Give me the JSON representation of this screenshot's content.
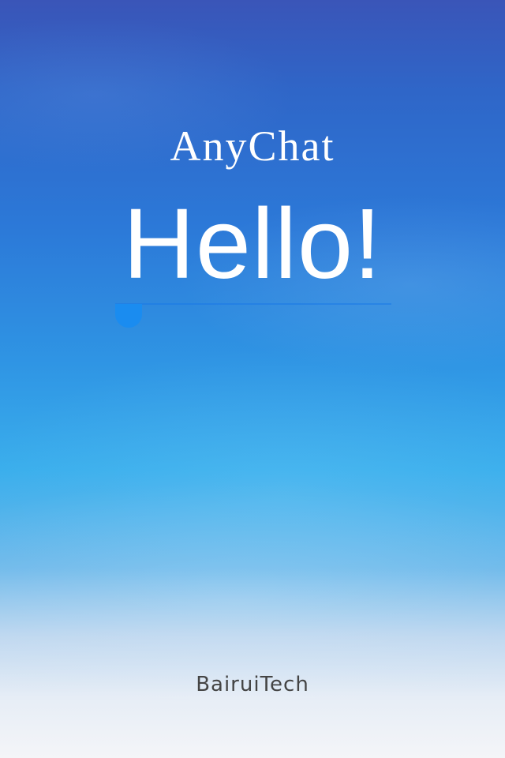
{
  "splash": {
    "brand_title": "AnyChat",
    "headline": "Hello!",
    "footer_company": "BairuiTech"
  },
  "loading": {
    "progress": 0.0
  },
  "colors": {
    "background_top": "#3a55b8",
    "background_middle": "#2f95e4",
    "background_bottom": "#f4f5f8",
    "accent": "#1a8cf0",
    "text_primary": "#ffffff",
    "text_footer": "#444444"
  }
}
